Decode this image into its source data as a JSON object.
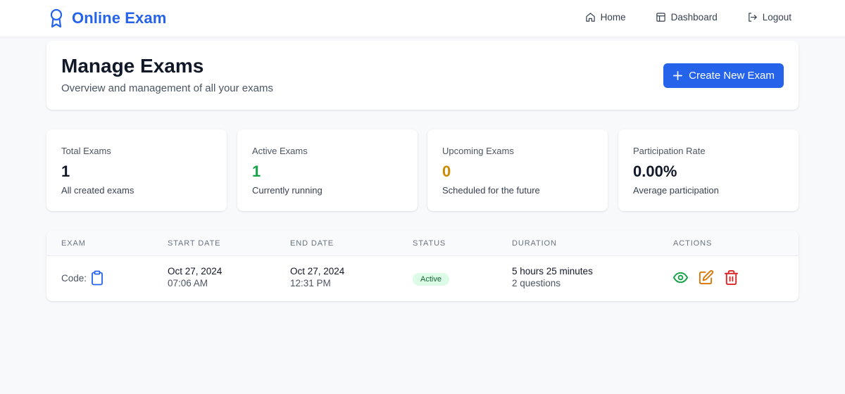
{
  "app": {
    "brand": "Online Exam",
    "brand_color": "#2563eb"
  },
  "nav": {
    "items": [
      {
        "label": "Home",
        "icon": "home-icon"
      },
      {
        "label": "Dashboard",
        "icon": "layout-icon"
      },
      {
        "label": "Logout",
        "icon": "logout-icon"
      }
    ]
  },
  "header": {
    "title": "Manage Exams",
    "subtitle": "Overview and management of all your exams",
    "create_button_label": "Create New Exam",
    "create_button_icon": "plus-icon"
  },
  "stats": [
    {
      "label": "Total Exams",
      "value": "1",
      "description": "All created exams",
      "value_color": "#111827"
    },
    {
      "label": "Active Exams",
      "value": "1",
      "description": "Currently running",
      "value_color": "#16a34a"
    },
    {
      "label": "Upcoming Exams",
      "value": "0",
      "description": "Scheduled for the future",
      "value_color": "#ca8a04"
    },
    {
      "label": "Participation Rate",
      "value": "0.00%",
      "description": "Average participation",
      "value_color": "#111827"
    }
  ],
  "table": {
    "columns": [
      "Exam",
      "Start Date",
      "End Date",
      "Status",
      "Duration",
      "Actions"
    ],
    "rows": [
      {
        "exam_code_label": "Code:",
        "exam_code_icon": "clipboard-icon",
        "start_date": "Oct 27, 2024",
        "start_time": "07:06 AM",
        "end_date": "Oct 27, 2024",
        "end_time": "12:31 PM",
        "status": "Active",
        "duration": "5 hours 25 minutes",
        "questions": "2 questions",
        "actions": [
          "view-icon",
          "edit-icon",
          "delete-icon"
        ]
      }
    ]
  },
  "colors": {
    "primary": "#2563eb",
    "success": "#16a34a",
    "warning": "#ca8a04",
    "danger": "#dc2626",
    "edit": "#d97706"
  }
}
